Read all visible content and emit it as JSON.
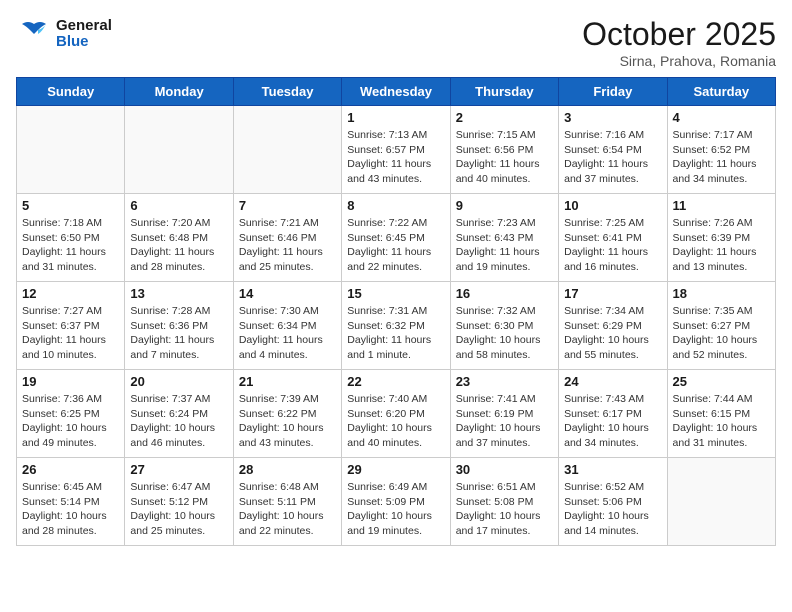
{
  "header": {
    "logo_line1": "General",
    "logo_line2": "Blue",
    "title": "October 2025",
    "subtitle": "Sirna, Prahova, Romania"
  },
  "weekdays": [
    "Sunday",
    "Monday",
    "Tuesday",
    "Wednesday",
    "Thursday",
    "Friday",
    "Saturday"
  ],
  "weeks": [
    [
      {
        "day": "",
        "info": ""
      },
      {
        "day": "",
        "info": ""
      },
      {
        "day": "",
        "info": ""
      },
      {
        "day": "1",
        "info": "Sunrise: 7:13 AM\nSunset: 6:57 PM\nDaylight: 11 hours and 43 minutes."
      },
      {
        "day": "2",
        "info": "Sunrise: 7:15 AM\nSunset: 6:56 PM\nDaylight: 11 hours and 40 minutes."
      },
      {
        "day": "3",
        "info": "Sunrise: 7:16 AM\nSunset: 6:54 PM\nDaylight: 11 hours and 37 minutes."
      },
      {
        "day": "4",
        "info": "Sunrise: 7:17 AM\nSunset: 6:52 PM\nDaylight: 11 hours and 34 minutes."
      }
    ],
    [
      {
        "day": "5",
        "info": "Sunrise: 7:18 AM\nSunset: 6:50 PM\nDaylight: 11 hours and 31 minutes."
      },
      {
        "day": "6",
        "info": "Sunrise: 7:20 AM\nSunset: 6:48 PM\nDaylight: 11 hours and 28 minutes."
      },
      {
        "day": "7",
        "info": "Sunrise: 7:21 AM\nSunset: 6:46 PM\nDaylight: 11 hours and 25 minutes."
      },
      {
        "day": "8",
        "info": "Sunrise: 7:22 AM\nSunset: 6:45 PM\nDaylight: 11 hours and 22 minutes."
      },
      {
        "day": "9",
        "info": "Sunrise: 7:23 AM\nSunset: 6:43 PM\nDaylight: 11 hours and 19 minutes."
      },
      {
        "day": "10",
        "info": "Sunrise: 7:25 AM\nSunset: 6:41 PM\nDaylight: 11 hours and 16 minutes."
      },
      {
        "day": "11",
        "info": "Sunrise: 7:26 AM\nSunset: 6:39 PM\nDaylight: 11 hours and 13 minutes."
      }
    ],
    [
      {
        "day": "12",
        "info": "Sunrise: 7:27 AM\nSunset: 6:37 PM\nDaylight: 11 hours and 10 minutes."
      },
      {
        "day": "13",
        "info": "Sunrise: 7:28 AM\nSunset: 6:36 PM\nDaylight: 11 hours and 7 minutes."
      },
      {
        "day": "14",
        "info": "Sunrise: 7:30 AM\nSunset: 6:34 PM\nDaylight: 11 hours and 4 minutes."
      },
      {
        "day": "15",
        "info": "Sunrise: 7:31 AM\nSunset: 6:32 PM\nDaylight: 11 hours and 1 minute."
      },
      {
        "day": "16",
        "info": "Sunrise: 7:32 AM\nSunset: 6:30 PM\nDaylight: 10 hours and 58 minutes."
      },
      {
        "day": "17",
        "info": "Sunrise: 7:34 AM\nSunset: 6:29 PM\nDaylight: 10 hours and 55 minutes."
      },
      {
        "day": "18",
        "info": "Sunrise: 7:35 AM\nSunset: 6:27 PM\nDaylight: 10 hours and 52 minutes."
      }
    ],
    [
      {
        "day": "19",
        "info": "Sunrise: 7:36 AM\nSunset: 6:25 PM\nDaylight: 10 hours and 49 minutes."
      },
      {
        "day": "20",
        "info": "Sunrise: 7:37 AM\nSunset: 6:24 PM\nDaylight: 10 hours and 46 minutes."
      },
      {
        "day": "21",
        "info": "Sunrise: 7:39 AM\nSunset: 6:22 PM\nDaylight: 10 hours and 43 minutes."
      },
      {
        "day": "22",
        "info": "Sunrise: 7:40 AM\nSunset: 6:20 PM\nDaylight: 10 hours and 40 minutes."
      },
      {
        "day": "23",
        "info": "Sunrise: 7:41 AM\nSunset: 6:19 PM\nDaylight: 10 hours and 37 minutes."
      },
      {
        "day": "24",
        "info": "Sunrise: 7:43 AM\nSunset: 6:17 PM\nDaylight: 10 hours and 34 minutes."
      },
      {
        "day": "25",
        "info": "Sunrise: 7:44 AM\nSunset: 6:15 PM\nDaylight: 10 hours and 31 minutes."
      }
    ],
    [
      {
        "day": "26",
        "info": "Sunrise: 6:45 AM\nSunset: 5:14 PM\nDaylight: 10 hours and 28 minutes."
      },
      {
        "day": "27",
        "info": "Sunrise: 6:47 AM\nSunset: 5:12 PM\nDaylight: 10 hours and 25 minutes."
      },
      {
        "day": "28",
        "info": "Sunrise: 6:48 AM\nSunset: 5:11 PM\nDaylight: 10 hours and 22 minutes."
      },
      {
        "day": "29",
        "info": "Sunrise: 6:49 AM\nSunset: 5:09 PM\nDaylight: 10 hours and 19 minutes."
      },
      {
        "day": "30",
        "info": "Sunrise: 6:51 AM\nSunset: 5:08 PM\nDaylight: 10 hours and 17 minutes."
      },
      {
        "day": "31",
        "info": "Sunrise: 6:52 AM\nSunset: 5:06 PM\nDaylight: 10 hours and 14 minutes."
      },
      {
        "day": "",
        "info": ""
      }
    ]
  ]
}
